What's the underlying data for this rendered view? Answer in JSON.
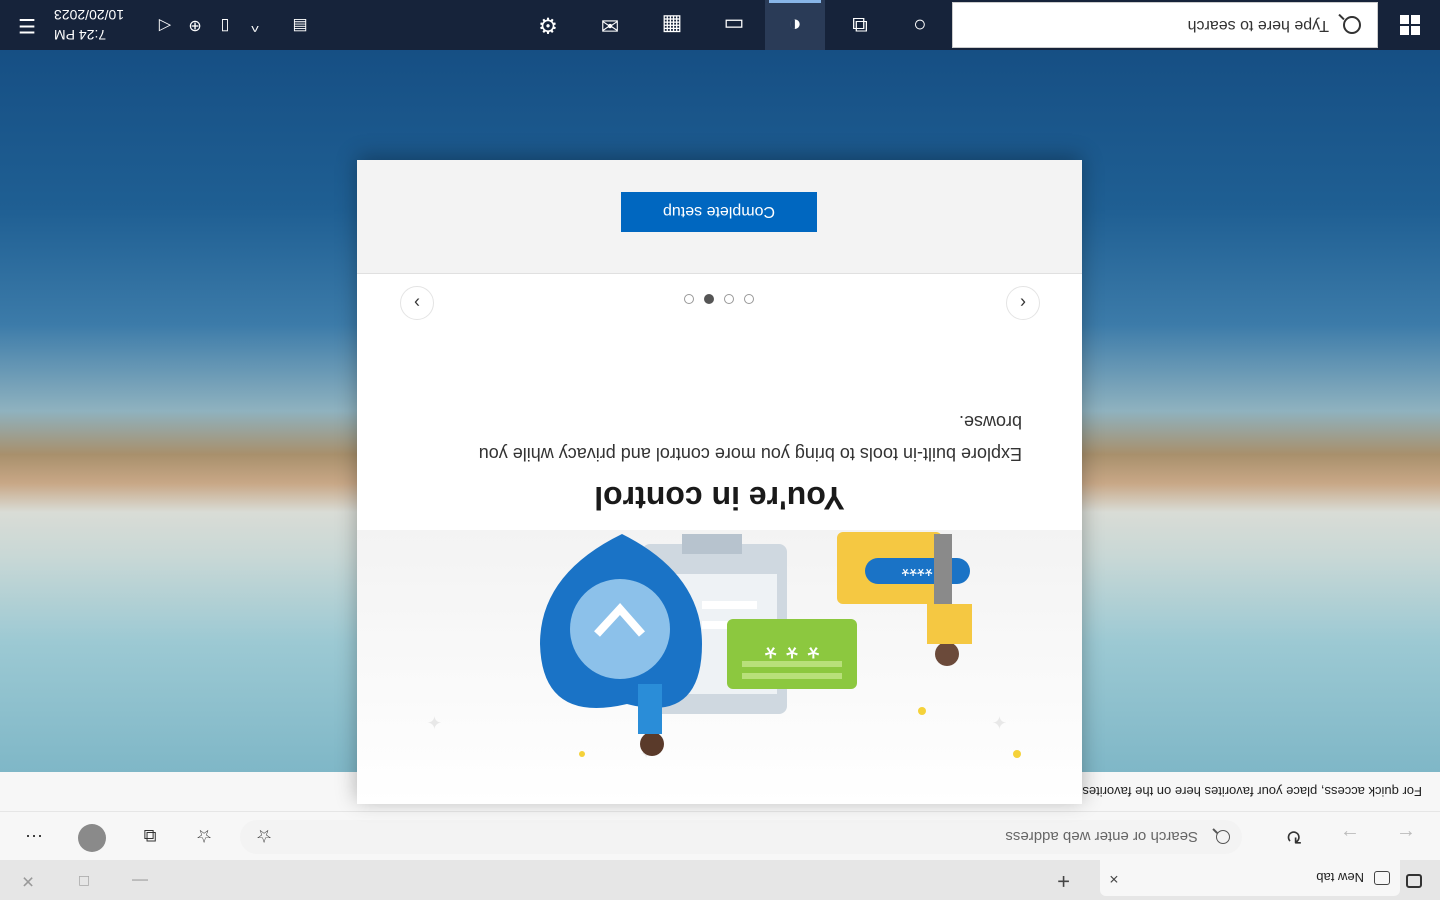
{
  "browser": {
    "tab_title": "New tab",
    "tab_close": "×",
    "new_tab": "+",
    "win_min": "—",
    "win_max": "□",
    "win_close": "✕",
    "back": "←",
    "forward": "→",
    "refresh": "↻",
    "address_placeholder": "Search or enter web address",
    "add_fav": "☆",
    "favorites": "☆",
    "collections": "⧉",
    "more": "⋯",
    "favbar_text": "For quick access, place your favorites here on the favorites bar."
  },
  "dialog": {
    "title": "You're in control",
    "description": "Explore built-in tools to bring you more control and privacy while you browse.",
    "prev": "‹",
    "next": "›",
    "dots": 4,
    "active_dot": 3,
    "button": "Complete setup",
    "button_color": "#0067c0",
    "illus_bubble1": "****",
    "illus_bubble2": "* * *"
  },
  "taskbar": {
    "search_placeholder": "Type here to search",
    "clock_time": "7:24 PM",
    "clock_date": "10/20/2023",
    "icons": [
      "cortana-icon",
      "task-view-icon",
      "edge-icon",
      "file-explorer-icon",
      "store-icon",
      "mail-icon",
      "settings-icon"
    ],
    "tray_chevron": "^",
    "background": "#16233a"
  }
}
